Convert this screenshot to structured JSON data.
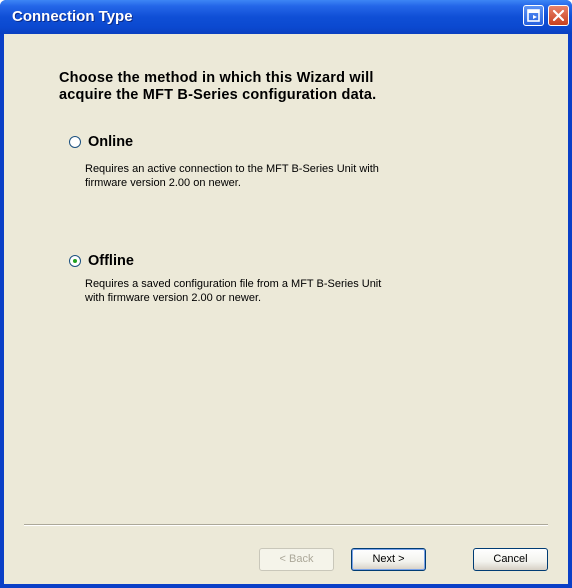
{
  "window": {
    "title": "Connection Type"
  },
  "wizard": {
    "heading_line1": "Choose the method in which this Wizard will",
    "heading_line2": "acquire the MFT B-Series configuration data.",
    "options": [
      {
        "label": "Online",
        "checked": false,
        "desc_line1": "Requires an active connection to the MFT B-Series Unit with",
        "desc_line2": "firmware version 2.00 on newer."
      },
      {
        "label": "Offline",
        "checked": true,
        "desc_line1": "Requires a saved configuration file from a MFT B-Series Unit",
        "desc_line2": "with firmware version 2.00 or newer."
      }
    ]
  },
  "buttons": {
    "back": "< Back",
    "next": "Next >",
    "cancel": "Cancel"
  },
  "icons": {
    "restore": "restore-icon",
    "close": "close-icon"
  },
  "colors": {
    "titlebar": "#0b49d0",
    "dialog_bg": "#ece9d8",
    "radio_dot": "#21a121"
  }
}
